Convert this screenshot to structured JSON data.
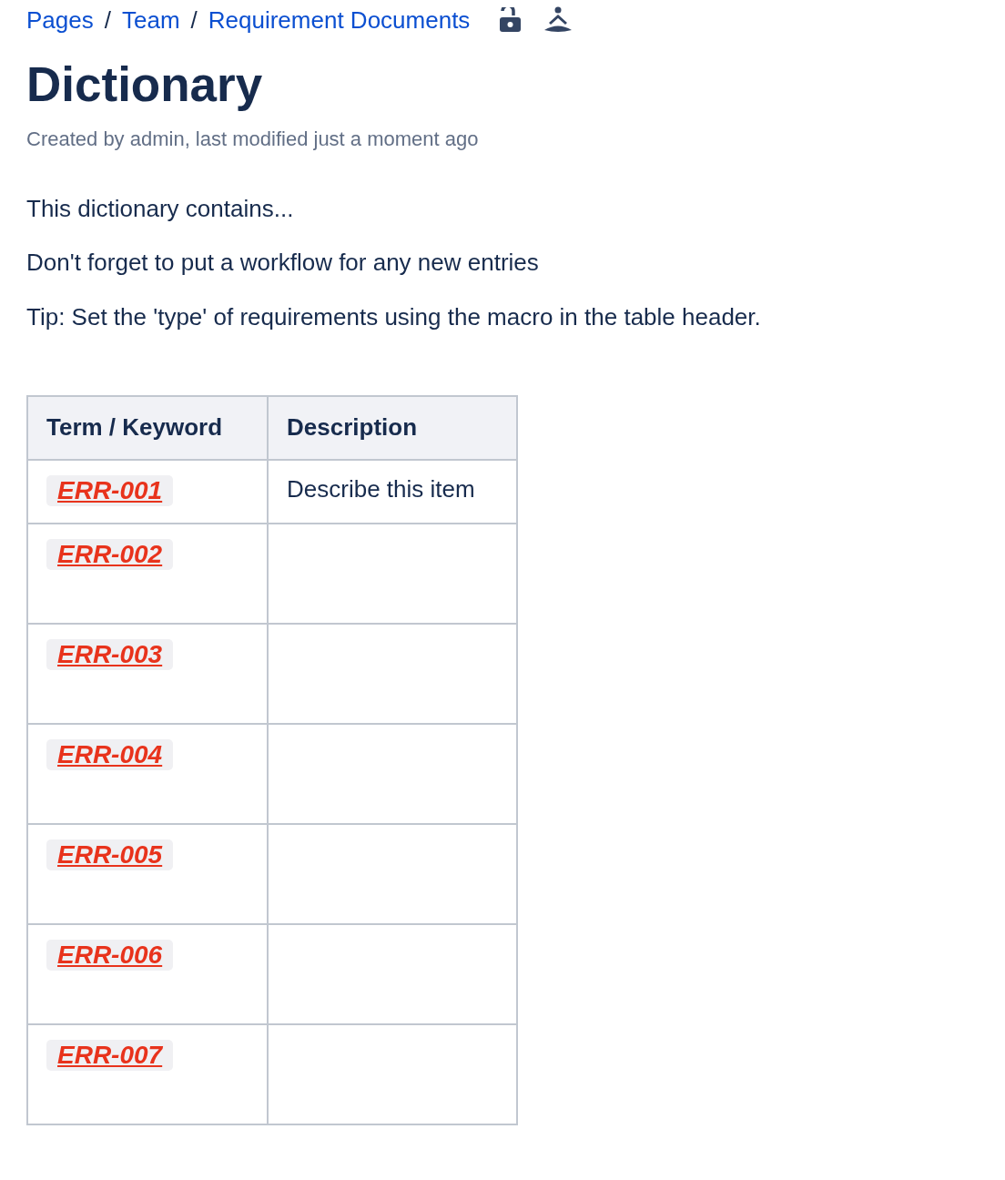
{
  "breadcrumbs": [
    "Pages",
    "Team",
    "Requirement Documents"
  ],
  "breadcrumb_separator": "/",
  "title": "Dictionary",
  "byline": "Created by admin, last modified just a moment ago",
  "paragraphs": [
    "This dictionary contains...",
    "Don't forget to put a workflow for any new entries",
    "Tip: Set the 'type' of requirements using the macro in the table header."
  ],
  "table": {
    "columns": [
      "Term / Keyword",
      "Description"
    ],
    "rows": [
      {
        "term": "ERR-001",
        "description": "Describe this item"
      },
      {
        "term": "ERR-002"
      },
      {
        "term": "ERR-003"
      },
      {
        "term": "ERR-004"
      },
      {
        "term": "ERR-005"
      },
      {
        "term": "ERR-006"
      },
      {
        "term": "ERR-007"
      }
    ]
  }
}
